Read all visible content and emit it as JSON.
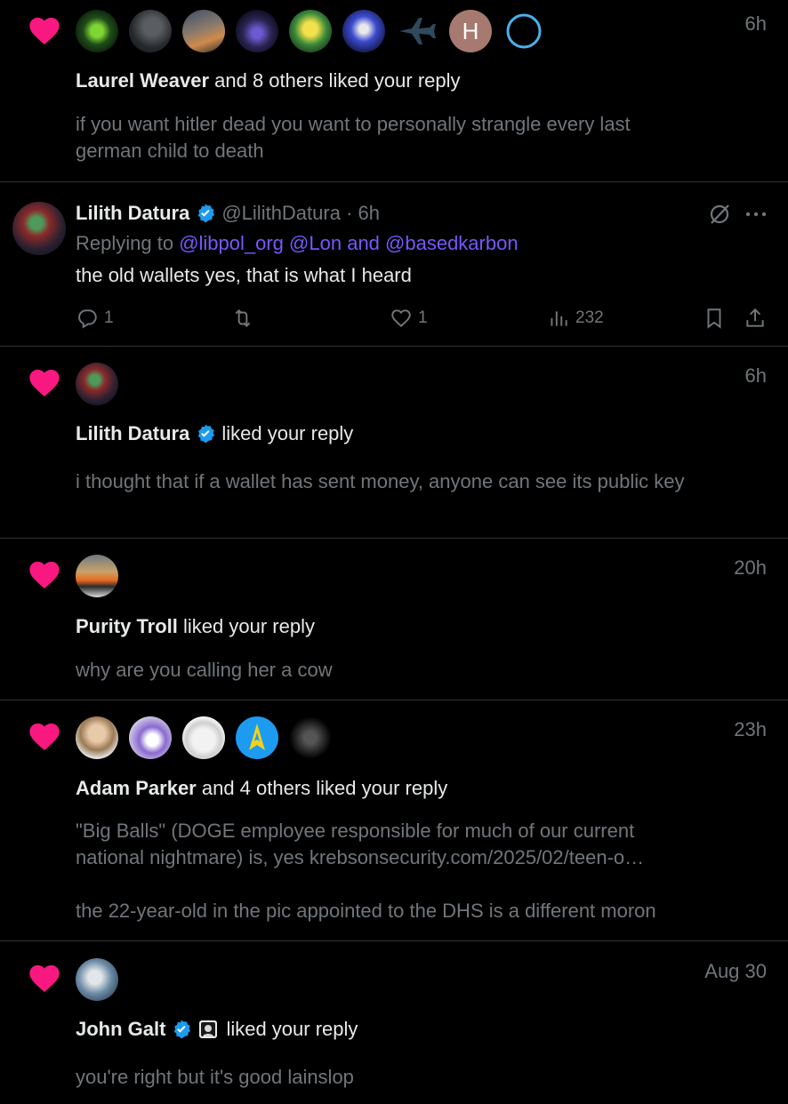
{
  "colors": {
    "heart": "#f91880",
    "verified": "#1d9bf0",
    "mention": "#7856ff",
    "muted": "#71767b",
    "text": "#e7e9ea",
    "divider": "#2f3336"
  },
  "notifications": [
    {
      "time": "6h",
      "name": "Laurel Weaver",
      "action": " and 8 others liked your reply",
      "excerpt": "if you want hitler dead you want to personally strangle every last german child to death",
      "avatar_initial": "H"
    },
    {
      "time": "6h",
      "name": "Lilith Datura",
      "action": "liked your reply",
      "excerpt": "i thought that if a wallet has sent money, anyone can see its public key"
    },
    {
      "time": "20h",
      "name": "Purity Troll",
      "action": " liked your reply",
      "excerpt": "why are you calling her a cow"
    },
    {
      "time": "23h",
      "name": "Adam Parker",
      "action": " and 4 others liked your reply",
      "excerpt_line1": "\"Big Balls\" (DOGE employee responsible for much of our current national nightmare) is, yes krebsonsecurity.com/2025/02/teen-o…",
      "excerpt_line2": "the 22-year-old in the pic appointed to the DHS is a different moron"
    },
    {
      "time": "Aug 30",
      "name": "John Galt",
      "action": "liked your reply",
      "excerpt": "you're right but it's good lainslop"
    }
  ],
  "tweet": {
    "name": "Lilith Datura",
    "handle": "@LilithDatura",
    "sep": " · ",
    "time": "6h",
    "replying_prefix": "Replying to ",
    "mention1": "@libpol_org",
    "mention2": "@Lon",
    "and": " and ",
    "mention3": "@basedkarbon",
    "text": "the old wallets yes, that is what I heard",
    "replies": "1",
    "likes": "1",
    "views": "232"
  }
}
